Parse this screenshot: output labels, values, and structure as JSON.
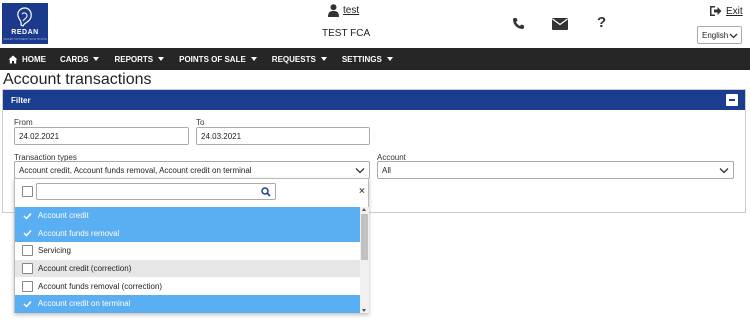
{
  "logo": {
    "text": "REDAN",
    "subtext": "SMART PAYMENT SOLUTIONS"
  },
  "user": {
    "name": "test",
    "company": "TEST FCA"
  },
  "header": {
    "exit_label": "Exit",
    "language": "English",
    "help_label": "?"
  },
  "nav": [
    {
      "label": "HOME",
      "icon": "home-icon"
    },
    {
      "label": "CARDS"
    },
    {
      "label": "REPORTS"
    },
    {
      "label": "POINTS OF SALE"
    },
    {
      "label": "REQUESTS"
    },
    {
      "label": "SETTINGS"
    }
  ],
  "page": {
    "title": "Account transactions"
  },
  "filter": {
    "title": "Filter",
    "from_label": "From",
    "from_value": "24.02.2021",
    "to_label": "To",
    "to_value": "24.03.2021",
    "types_label": "Transaction types",
    "types_value": "Account credit, Account funds removal, Account credit on terminal",
    "account_label": "Account",
    "account_value": "All"
  },
  "dropdown": {
    "search_placeholder": "",
    "clear_symbol": "×",
    "items": [
      {
        "label": "Account credit",
        "selected": true
      },
      {
        "label": "Account funds removal",
        "selected": true
      },
      {
        "label": "Servicing",
        "selected": false
      },
      {
        "label": "Account credit (correction)",
        "selected": false
      },
      {
        "label": "Account funds removal (correction)",
        "selected": false
      },
      {
        "label": "Account credit on terminal",
        "selected": true
      }
    ]
  },
  "colors": {
    "header_blue": "#1b3d8f",
    "nav_dark": "#262626",
    "selected_blue": "#5aaef2"
  }
}
